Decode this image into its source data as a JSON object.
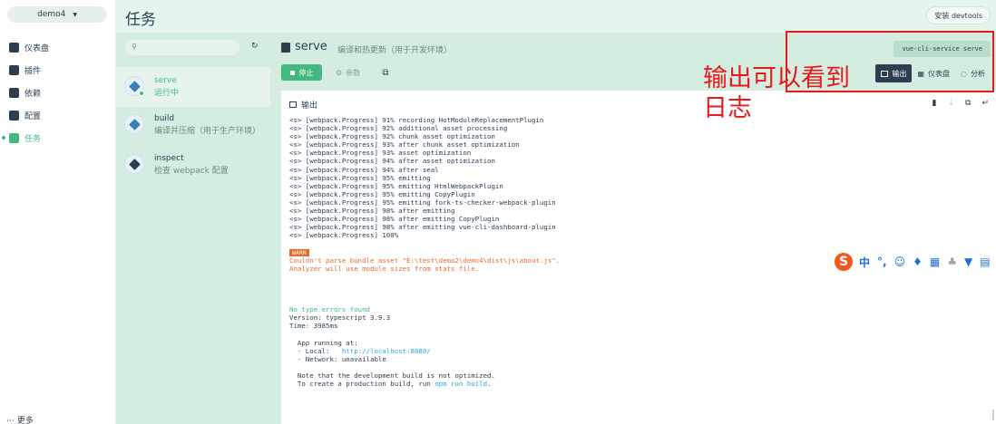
{
  "nav": {
    "project": "demo4",
    "items": [
      {
        "label": "仪表盘",
        "icon": "dashboard-icon"
      },
      {
        "label": "插件",
        "icon": "puzzle-icon"
      },
      {
        "label": "依赖",
        "icon": "book-icon"
      },
      {
        "label": "配置",
        "icon": "settings-icon"
      },
      {
        "label": "任务",
        "icon": "tasks-icon",
        "active": true
      }
    ],
    "more": "更多"
  },
  "header": {
    "title": "任务",
    "devtools_button": "安装 devtools"
  },
  "tasks": {
    "search_placeholder": "",
    "list": [
      {
        "name": "serve",
        "desc": "运行中",
        "selected": true
      },
      {
        "name": "build",
        "desc": "编译并压缩（用于生产环境）"
      },
      {
        "name": "inspect",
        "desc": "检查 webpack 配置"
      }
    ]
  },
  "task_detail": {
    "name": "serve",
    "description": "编译和热更新（用于开发环境）",
    "command": "vue-cli-service serve",
    "stop_label": "停止",
    "params_label": "参数",
    "views": [
      "输出",
      "仪表盘",
      "分析"
    ],
    "active_view": "输出"
  },
  "annotation": {
    "text": "输出可以看到日志",
    "color": "#e8191b"
  },
  "output": {
    "title": "输出",
    "progress_lines": [
      "<s> [webpack.Progress] 91% recording HotModuleReplacementPlugin",
      "<s> [webpack.Progress] 92% additional asset processing",
      "<s> [webpack.Progress] 92% chunk asset optimization",
      "<s> [webpack.Progress] 93% after chunk asset optimization",
      "<s> [webpack.Progress] 93% asset optimization",
      "<s> [webpack.Progress] 94% after asset optimization",
      "<s> [webpack.Progress] 94% after seal",
      "<s> [webpack.Progress] 95% emitting",
      "<s> [webpack.Progress] 95% emitting HtmlWebpackPlugin",
      "<s> [webpack.Progress] 95% emitting CopyPlugin",
      "<s> [webpack.Progress] 95% emitting fork-ts-checker-webpack-plugin",
      "<s> [webpack.Progress] 98% after emitting",
      "<s> [webpack.Progress] 98% after emitting CopyPlugin",
      "<s> [webpack.Progress] 98% after emitting vue-cli-dashboard-plugin",
      "<s> [webpack.Progress] 100%"
    ],
    "warn_tag": "WARN",
    "warn_lines": [
      "Couldn't parse bundle asset \"E:\\test\\demo2\\demo4\\dist\\js\\about.js\".",
      "Analyzer will use module sizes from stats file."
    ],
    "ok_line": "No type errors found",
    "info_lines": [
      "Version: typescript 3.9.3",
      "Time: 3985ms"
    ],
    "app_running": "  App running at:",
    "local_label": "  - Local:   ",
    "local_url": "http://localhost:8080/",
    "network_line": "  - Network: unavailable",
    "note_line": "  Note that the development build is not optimized.",
    "build_prefix": "  To create a production build, run ",
    "build_cmd": "npm run build",
    "build_suffix": "."
  },
  "colors": {
    "accent": "#42b983",
    "dark": "#2c3e50",
    "warn": "#e8692c"
  },
  "ime": {
    "chinese": "中"
  }
}
